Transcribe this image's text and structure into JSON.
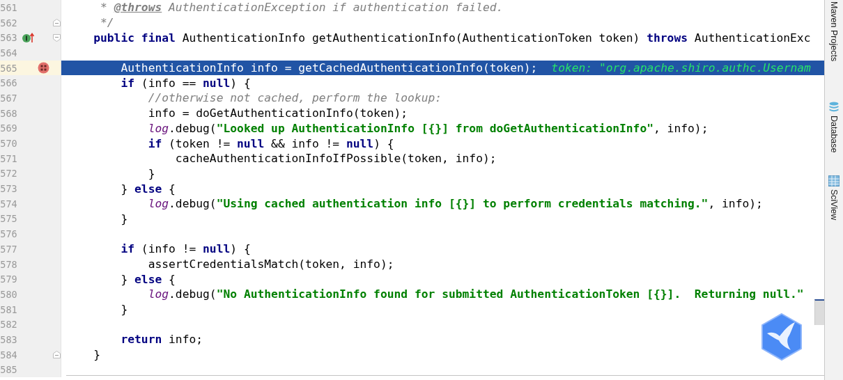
{
  "editor": {
    "lines": [
      {
        "number": "561",
        "current": false,
        "breakpoint": false,
        "implements": false,
        "fold_start": false,
        "fold_end": false,
        "segments": [
          {
            "kind": "comment",
            "text": "     * "
          },
          {
            "kind": "doc-tag",
            "text": "@throws"
          },
          {
            "kind": "comment",
            "text": " AuthenticationException if authentication failed."
          }
        ]
      },
      {
        "number": "562",
        "current": false,
        "breakpoint": false,
        "implements": false,
        "fold_start": false,
        "fold_end": true,
        "segments": [
          {
            "kind": "comment",
            "text": "     */"
          }
        ]
      },
      {
        "number": "563",
        "current": false,
        "breakpoint": false,
        "implements": true,
        "fold_start": true,
        "fold_end": false,
        "segments": [
          {
            "kind": "keyword",
            "text": "    public final"
          },
          {
            "kind": "plain",
            "text": " AuthenticationInfo getAuthenticationInfo(AuthenticationToken token) "
          },
          {
            "kind": "keyword",
            "text": "throws"
          },
          {
            "kind": "plain",
            "text": " AuthenticationExc"
          }
        ]
      },
      {
        "number": "564",
        "current": false,
        "breakpoint": false,
        "implements": false,
        "fold_start": false,
        "fold_end": false
      },
      {
        "number": "565",
        "current": true,
        "breakpoint": true,
        "implements": false,
        "fold_start": false,
        "fold_end": false,
        "segments": [
          {
            "kind": "plain",
            "text": "        AuthenticationInfo info = getCachedAuthenticationInfo(token);"
          },
          {
            "kind": "hint",
            "text": "token: \"org.apache.shiro.authc.Usernam"
          }
        ]
      },
      {
        "number": "566",
        "current": false,
        "breakpoint": false,
        "implements": false,
        "fold_start": false,
        "fold_end": false,
        "segments": [
          {
            "kind": "keyword",
            "text": "        if"
          },
          {
            "kind": "plain",
            "text": " (info == "
          },
          {
            "kind": "keyword",
            "text": "null"
          },
          {
            "kind": "plain",
            "text": ") {"
          }
        ]
      },
      {
        "number": "567",
        "current": false,
        "breakpoint": false,
        "implements": false,
        "fold_start": false,
        "fold_end": false,
        "segments": [
          {
            "kind": "comment",
            "text": "            //otherwise not cached, perform the lookup:"
          }
        ]
      },
      {
        "number": "568",
        "current": false,
        "breakpoint": false,
        "implements": false,
        "fold_start": false,
        "fold_end": false,
        "segments": [
          {
            "kind": "plain",
            "text": "            info = doGetAuthenticationInfo(token);"
          }
        ]
      },
      {
        "number": "569",
        "current": false,
        "breakpoint": false,
        "implements": false,
        "fold_start": false,
        "fold_end": false,
        "segments": [
          {
            "kind": "field",
            "text": "            log"
          },
          {
            "kind": "plain",
            "text": ".debug("
          },
          {
            "kind": "string",
            "text": "\"Looked up AuthenticationInfo [{}] from doGetAuthenticationInfo\""
          },
          {
            "kind": "plain",
            "text": ", info);"
          }
        ]
      },
      {
        "number": "570",
        "current": false,
        "breakpoint": false,
        "implements": false,
        "fold_start": false,
        "fold_end": false,
        "segments": [
          {
            "kind": "keyword",
            "text": "            if"
          },
          {
            "kind": "plain",
            "text": " (token != "
          },
          {
            "kind": "keyword",
            "text": "null"
          },
          {
            "kind": "plain",
            "text": " && info != "
          },
          {
            "kind": "keyword",
            "text": "null"
          },
          {
            "kind": "plain",
            "text": ") {"
          }
        ]
      },
      {
        "number": "571",
        "current": false,
        "breakpoint": false,
        "implements": false,
        "fold_start": false,
        "fold_end": false,
        "segments": [
          {
            "kind": "plain",
            "text": "                cacheAuthenticationInfoIfPossible(token, info);"
          }
        ]
      },
      {
        "number": "572",
        "current": false,
        "breakpoint": false,
        "implements": false,
        "fold_start": false,
        "fold_end": false,
        "segments": [
          {
            "kind": "plain",
            "text": "            }"
          }
        ]
      },
      {
        "number": "573",
        "current": false,
        "breakpoint": false,
        "implements": false,
        "fold_start": false,
        "fold_end": false,
        "segments": [
          {
            "kind": "plain",
            "text": "        } "
          },
          {
            "kind": "keyword",
            "text": "else"
          },
          {
            "kind": "plain",
            "text": " {"
          }
        ]
      },
      {
        "number": "574",
        "current": false,
        "breakpoint": false,
        "implements": false,
        "fold_start": false,
        "fold_end": false,
        "segments": [
          {
            "kind": "field",
            "text": "            log"
          },
          {
            "kind": "plain",
            "text": ".debug("
          },
          {
            "kind": "string",
            "text": "\"Using cached authentication info [{}] to perform credentials matching.\""
          },
          {
            "kind": "plain",
            "text": ", info);"
          }
        ]
      },
      {
        "number": "575",
        "current": false,
        "breakpoint": false,
        "implements": false,
        "fold_start": false,
        "fold_end": false,
        "segments": [
          {
            "kind": "plain",
            "text": "        }"
          }
        ]
      },
      {
        "number": "576",
        "current": false,
        "breakpoint": false,
        "implements": false,
        "fold_start": false,
        "fold_end": false
      },
      {
        "number": "577",
        "current": false,
        "breakpoint": false,
        "implements": false,
        "fold_start": false,
        "fold_end": false,
        "segments": [
          {
            "kind": "keyword",
            "text": "        if"
          },
          {
            "kind": "plain",
            "text": " (info != "
          },
          {
            "kind": "keyword",
            "text": "null"
          },
          {
            "kind": "plain",
            "text": ") {"
          }
        ]
      },
      {
        "number": "578",
        "current": false,
        "breakpoint": false,
        "implements": false,
        "fold_start": false,
        "fold_end": false,
        "segments": [
          {
            "kind": "plain",
            "text": "            assertCredentialsMatch(token, info);"
          }
        ]
      },
      {
        "number": "579",
        "current": false,
        "breakpoint": false,
        "implements": false,
        "fold_start": false,
        "fold_end": false,
        "segments": [
          {
            "kind": "plain",
            "text": "        } "
          },
          {
            "kind": "keyword",
            "text": "else"
          },
          {
            "kind": "plain",
            "text": " {"
          }
        ]
      },
      {
        "number": "580",
        "current": false,
        "breakpoint": false,
        "implements": false,
        "fold_start": false,
        "fold_end": false,
        "segments": [
          {
            "kind": "field",
            "text": "            log"
          },
          {
            "kind": "plain",
            "text": ".debug("
          },
          {
            "kind": "string",
            "text": "\"No AuthenticationInfo found for submitted AuthenticationToken [{}].  Returning null.\""
          }
        ]
      },
      {
        "number": "581",
        "current": false,
        "breakpoint": false,
        "implements": false,
        "fold_start": false,
        "fold_end": false,
        "segments": [
          {
            "kind": "plain",
            "text": "        }"
          }
        ]
      },
      {
        "number": "582",
        "current": false,
        "breakpoint": false,
        "implements": false,
        "fold_start": false,
        "fold_end": false
      },
      {
        "number": "583",
        "current": false,
        "breakpoint": false,
        "implements": false,
        "fold_start": false,
        "fold_end": false,
        "segments": [
          {
            "kind": "keyword",
            "text": "        return"
          },
          {
            "kind": "plain",
            "text": " info;"
          }
        ]
      },
      {
        "number": "584",
        "current": false,
        "breakpoint": false,
        "implements": false,
        "fold_start": false,
        "fold_end": true,
        "segments": [
          {
            "kind": "plain",
            "text": "    }"
          }
        ]
      },
      {
        "number": "585",
        "current": false,
        "breakpoint": false,
        "implements": false,
        "fold_start": false,
        "fold_end": false
      }
    ]
  },
  "tool_strip": [
    {
      "kind": "maven",
      "label": "Maven Projects"
    },
    {
      "kind": "database",
      "label": "Database"
    },
    {
      "kind": "sciview",
      "label": "SciView"
    }
  ]
}
